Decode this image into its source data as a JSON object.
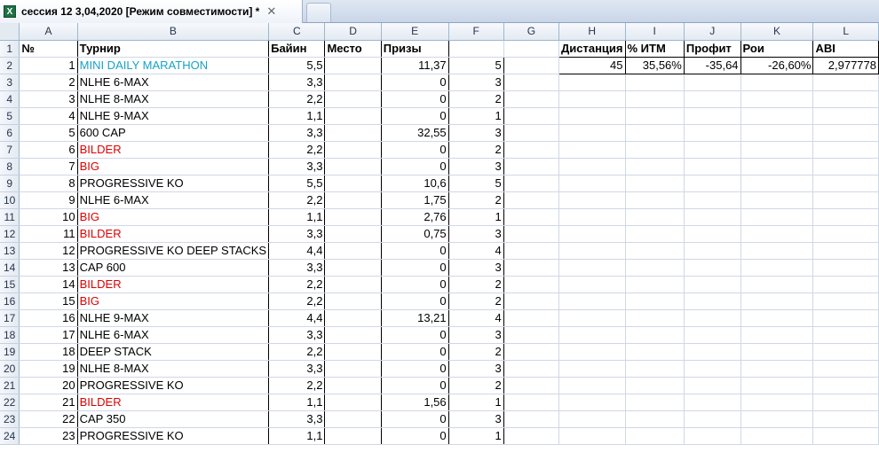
{
  "tab": {
    "title": "сессия 12 3,04,2020  [Режим совместимости] *",
    "close_glyph": "✕",
    "icon_glyph": "X"
  },
  "colors": {
    "blue_text": "#17a2c7",
    "red_text": "#e00000"
  },
  "columns": [
    "A",
    "B",
    "C",
    "D",
    "E",
    "F",
    "G",
    "H",
    "I",
    "J",
    "K",
    "L"
  ],
  "header_row": {
    "A": "№",
    "B": "Турнир",
    "C": "Байин",
    "D": "Место",
    "E": "Призы",
    "H": "Дистанция",
    "I": "% ИТМ",
    "J": "Профит",
    "K": "Рои",
    "L": "ABI"
  },
  "stats": {
    "H": "45",
    "I": "35,56%",
    "J": "-35,64",
    "K": "-26,60%",
    "L": "2,977778"
  },
  "rows": [
    {
      "n": "1",
      "name": "MINI DAILY MARATHON",
      "color": "blue",
      "buyin": "5,5",
      "prize": "11,37",
      "f": "5"
    },
    {
      "n": "2",
      "name": "NLHE 6-MAX",
      "color": "black",
      "buyin": "3,3",
      "prize": "0",
      "f": "3"
    },
    {
      "n": "3",
      "name": "NLHE 8-MAX",
      "color": "black",
      "buyin": "2,2",
      "prize": "0",
      "f": "2"
    },
    {
      "n": "4",
      "name": "NLHE 9-MAX",
      "color": "black",
      "buyin": "1,1",
      "prize": "0",
      "f": "1"
    },
    {
      "n": "5",
      "name": "600 CAP",
      "color": "black",
      "buyin": "3,3",
      "prize": "32,55",
      "f": "3"
    },
    {
      "n": "6",
      "name": "BILDER",
      "color": "red",
      "buyin": "2,2",
      "prize": "0",
      "f": "2"
    },
    {
      "n": "7",
      "name": "BIG",
      "color": "red",
      "buyin": "3,3",
      "prize": "0",
      "f": "3"
    },
    {
      "n": "8",
      "name": "PROGRESSIVE KO",
      "color": "black",
      "buyin": "5,5",
      "prize": "10,6",
      "f": "5"
    },
    {
      "n": "9",
      "name": "NLHE 6-MAX",
      "color": "black",
      "buyin": "2,2",
      "prize": "1,75",
      "f": "2"
    },
    {
      "n": "10",
      "name": "BIG",
      "color": "red",
      "buyin": "1,1",
      "prize": "2,76",
      "f": "1"
    },
    {
      "n": "11",
      "name": "BILDER",
      "color": "red",
      "buyin": "3,3",
      "prize": "0,75",
      "f": "3"
    },
    {
      "n": "12",
      "name": "PROGRESSIVE KO DEEP STACKS",
      "color": "black",
      "buyin": "4,4",
      "prize": "0",
      "f": "4"
    },
    {
      "n": "13",
      "name": "CAP 600",
      "color": "black",
      "buyin": "3,3",
      "prize": "0",
      "f": "3"
    },
    {
      "n": "14",
      "name": "BILDER",
      "color": "red",
      "buyin": "2,2",
      "prize": "0",
      "f": "2"
    },
    {
      "n": "15",
      "name": "BIG",
      "color": "red",
      "buyin": "2,2",
      "prize": "0",
      "f": "2"
    },
    {
      "n": "16",
      "name": "NLHE 9-MAX",
      "color": "black",
      "buyin": "4,4",
      "prize": "13,21",
      "f": "4"
    },
    {
      "n": "17",
      "name": "NLHE 6-MAX",
      "color": "black",
      "buyin": "3,3",
      "prize": "0",
      "f": "3"
    },
    {
      "n": "18",
      "name": "DEEP STACK",
      "color": "black",
      "buyin": "2,2",
      "prize": "0",
      "f": "2"
    },
    {
      "n": "19",
      "name": "NLHE 8-MAX",
      "color": "black",
      "buyin": "3,3",
      "prize": "0",
      "f": "3"
    },
    {
      "n": "20",
      "name": "PROGRESSIVE KO",
      "color": "black",
      "buyin": "2,2",
      "prize": "0",
      "f": "2"
    },
    {
      "n": "21",
      "name": "BILDER",
      "color": "red",
      "buyin": "1,1",
      "prize": "1,56",
      "f": "1"
    },
    {
      "n": "22",
      "name": "CAP 350",
      "color": "black",
      "buyin": "3,3",
      "prize": "0",
      "f": "3"
    },
    {
      "n": "23",
      "name": "PROGRESSIVE KO",
      "color": "black",
      "buyin": "1,1",
      "prize": "0",
      "f": "1"
    }
  ]
}
